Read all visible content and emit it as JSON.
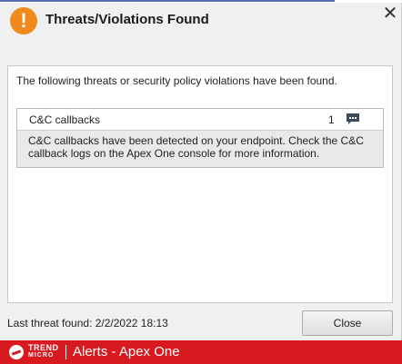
{
  "window": {
    "title": "Threats/Violations Found",
    "alert_icon_glyph": "!",
    "close_glyph": "✕"
  },
  "content": {
    "intro": "The following threats or security policy violations have been found.",
    "threats": [
      {
        "name": "C&C callbacks",
        "count": "1",
        "icon": "comment-icon",
        "description": "C&C callbacks have been detected on your endpoint. Check the C&C callback logs on the Apex One console for more information."
      }
    ]
  },
  "footer": {
    "last_threat": "Last threat found: 2/2/2022 18:13",
    "close_label": "Close"
  },
  "brand": {
    "word1": "TREND",
    "word2": "MICRO",
    "title": "Alerts - Apex One"
  },
  "colors": {
    "accent_orange": "#f08a1c",
    "brand_red": "#d71920"
  }
}
